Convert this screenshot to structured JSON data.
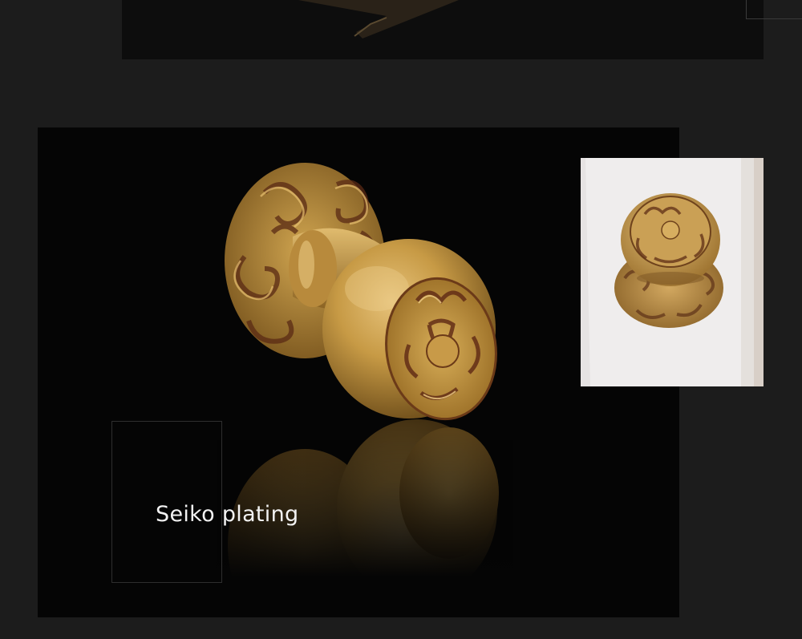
{
  "caption": {
    "text": "Seiko plating"
  },
  "colors": {
    "background": "#1c1c1c",
    "panel": "#050505",
    "brass": "#c9a04a",
    "caption_text": "#f2f2f2"
  },
  "icons": {
    "main_photo": "brass-door-knob-photo",
    "inset_photo": "installed-knob-photo"
  }
}
